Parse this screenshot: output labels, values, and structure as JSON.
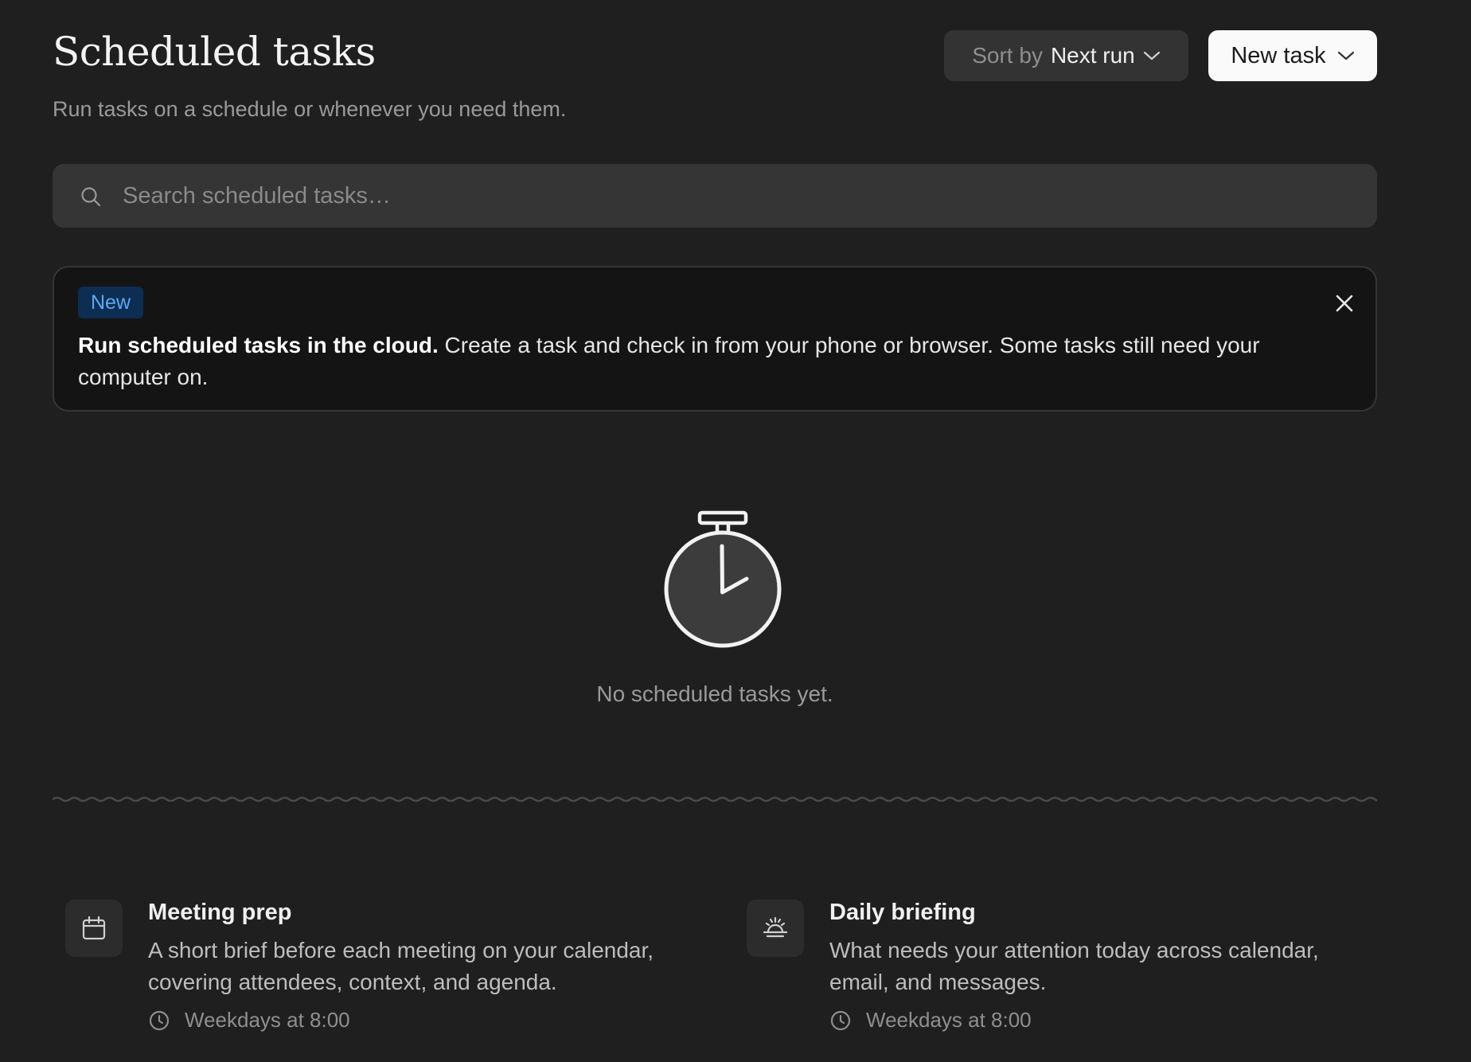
{
  "header": {
    "title": "Scheduled tasks",
    "subtitle": "Run tasks on a schedule or whenever you need them.",
    "sort_prefix": "Sort by",
    "sort_value": "Next run",
    "new_task_label": "New task"
  },
  "search": {
    "placeholder": "Search scheduled tasks…",
    "value": ""
  },
  "banner": {
    "badge": "New",
    "headline": "Run scheduled tasks in the cloud.",
    "body": " Create a task and check in from your phone or browser. Some tasks still need your computer on."
  },
  "empty_state": {
    "icon": "stopwatch-icon",
    "text": "No scheduled tasks yet."
  },
  "templates": [
    {
      "icon": "calendar-icon",
      "title": "Meeting prep",
      "description": "A short brief before each meeting on your calendar, covering attendees, context, and agenda.",
      "schedule": "Weekdays at 8:00"
    },
    {
      "icon": "sunrise-icon",
      "title": "Daily briefing",
      "description": "What needs your attention today across calendar, email, and messages.",
      "schedule": "Weekdays at 8:00"
    }
  ],
  "colors": {
    "background": "#1f1f1f",
    "badge_bg": "#0d2d52",
    "badge_text": "#5ea8f4",
    "primary_button_bg": "#fafafa"
  }
}
